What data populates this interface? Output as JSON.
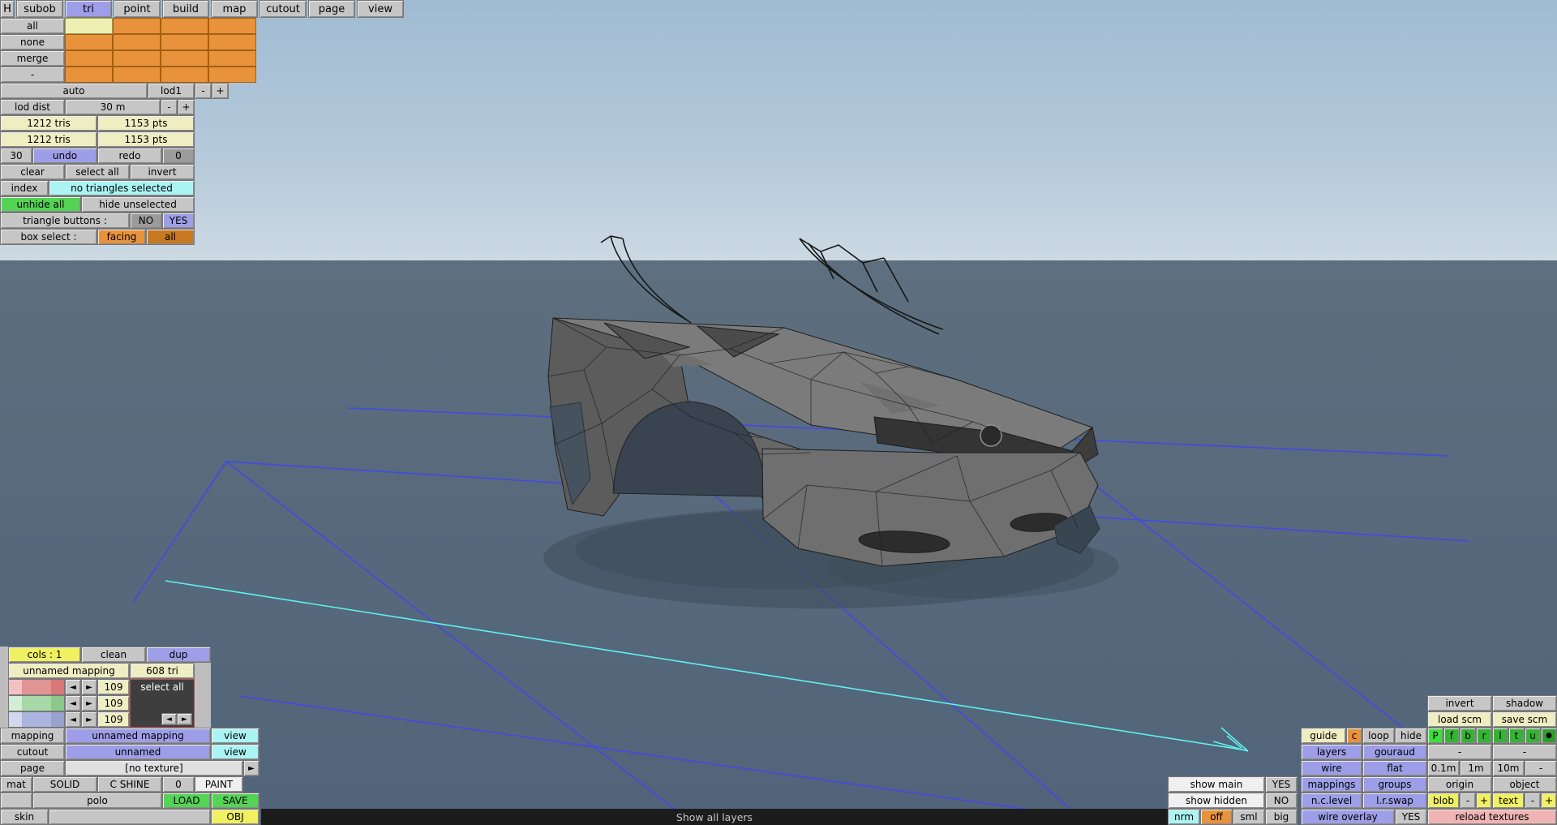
{
  "colors": {
    "sky_top": "#a0bbd2",
    "sky_horizon": "#ccd9e3",
    "ground": "#57697b",
    "panel_gray": "#c6c6c6",
    "accent_orange": "#e8923c",
    "accent_orange_dark": "#c87820",
    "accent_yellow": "#f0f060",
    "accent_cream": "#efedc2",
    "accent_lavender": "#9e9ee8",
    "accent_cyan": "#aaf4f4",
    "accent_green": "#54d454",
    "accent_green_bright": "#3ce03c",
    "accent_pink": "#f0b4b4",
    "grid_blue": "#4448e6",
    "grid_cyan": "#5ff0f0",
    "status_bg": "#1c1c1c"
  },
  "menu": {
    "items": [
      "H",
      "subob",
      "tri",
      "point",
      "build",
      "map",
      "cutout",
      "page",
      "view"
    ],
    "active_item": "tri"
  },
  "subob": {
    "row_labels": [
      "all",
      "none",
      "merge",
      "-"
    ]
  },
  "lod": {
    "auto_label": "auto",
    "lod_label": "lod1",
    "minus": "-",
    "plus": "+",
    "dist_label": "lod dist",
    "dist_value": "30 m"
  },
  "stats": {
    "rows": [
      {
        "tris": "1212 tris",
        "pts": "1153 pts"
      },
      {
        "tris": "1212 tris",
        "pts": "1153 pts"
      }
    ]
  },
  "history": {
    "undo_count": "30",
    "undo_label": "undo",
    "redo_label": "redo",
    "redo_count": "0"
  },
  "selection": {
    "clear": "clear",
    "select_all": "select all",
    "invert": "invert",
    "index": "index",
    "status": "no triangles selected",
    "unhide_all": "unhide all",
    "hide_unselected": "hide unselected",
    "triangle_buttons_label": "triangle buttons :",
    "no": "NO",
    "yes": "YES",
    "box_select_label": "box select :",
    "facing": "facing",
    "all": "all"
  },
  "mapping_panel": {
    "cols": "cols : 1",
    "clean": "clean",
    "dup": "dup",
    "name": "unnamed mapping",
    "tri_count": "608 tri",
    "arrow_left": "◄",
    "arrow_right": "►",
    "channels": [
      {
        "value": "109"
      },
      {
        "value": "109"
      },
      {
        "value": "109"
      }
    ],
    "select_all": "select all",
    "mapping_label": "mapping",
    "mapping_value": "unnamed mapping",
    "mapping_view": "view",
    "cutout_label": "cutout",
    "cutout_value": "unnamed",
    "cutout_view": "view",
    "page_label": "page",
    "page_value": "[no texture]",
    "page_next": "►",
    "mat_label": "mat",
    "solid": "SOLID",
    "c_shine": "C SHINE",
    "zero": "0",
    "paint": "PAINT",
    "model_name": "polo",
    "load": "LOAD",
    "save": "SAVE",
    "skin": "skin",
    "obj": "OBJ"
  },
  "view_panel": {
    "invert": "invert",
    "shadow": "shadow",
    "load_scm": "load scm",
    "save_scm": "save scm",
    "guide": "guide",
    "c": "c",
    "loop": "loop",
    "hide": "hide",
    "axis_buttons": [
      "P",
      "f",
      "b",
      "r",
      "l",
      "t",
      "u",
      "●"
    ],
    "layers": "layers",
    "gouraud": "gouraud",
    "dash_a": "-",
    "dash_b": "-",
    "wire": "wire",
    "flat": "flat",
    "scale_01": "0.1m",
    "scale_1": "1m",
    "scale_10": "10m",
    "scale_dash": "-",
    "show_main": "show main",
    "show_main_value": "YES",
    "mappings": "mappings",
    "groups": "groups",
    "origin": "origin",
    "object": "object",
    "show_hidden": "show hidden",
    "show_hidden_value": "NO",
    "nc_level": "n.c.level",
    "lr_swap": "l.r.swap",
    "blob": "blob",
    "blob_minus": "-",
    "blob_plus": "+",
    "text": "text",
    "text_minus": "-",
    "text_plus": "+",
    "nrm": "nrm",
    "off": "off",
    "sml": "sml",
    "big": "big",
    "wire_overlay": "wire overlay",
    "wire_overlay_value": "YES",
    "reload_textures": "reload textures"
  },
  "status": {
    "message": "Show all layers"
  }
}
